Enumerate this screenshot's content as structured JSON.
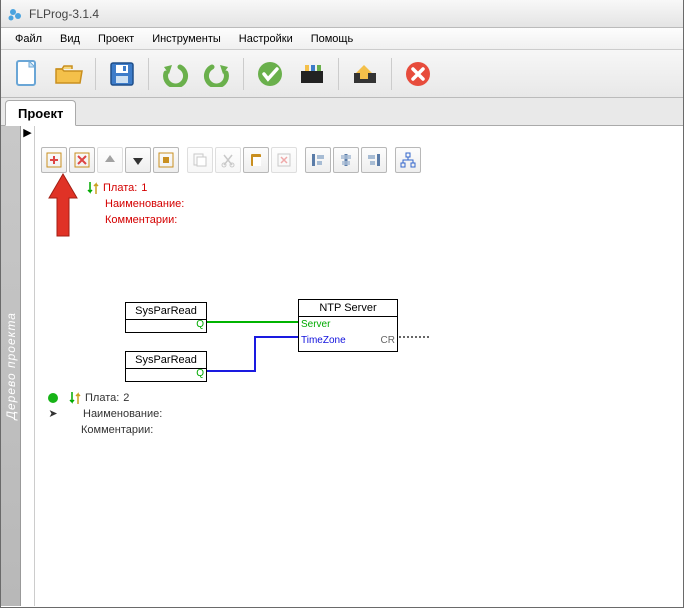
{
  "app": {
    "title": "FLProg-3.1.4"
  },
  "menu": {
    "file": "Файл",
    "view": "Вид",
    "project": "Проект",
    "tools": "Инструменты",
    "settings": "Настройки",
    "help": "Помощь"
  },
  "tab": {
    "project": "Проект"
  },
  "sidebar": {
    "label": "Дерево проекта"
  },
  "board1": {
    "plate_label": "Плата:",
    "plate_num": "1",
    "name_label": "Наименование:",
    "comment_label": "Комментарии:"
  },
  "board2": {
    "plate_label": "Плата:",
    "plate_num": "2",
    "name_label": "Наименование:",
    "comment_label": "Комментарии:"
  },
  "blocks": {
    "spr1": {
      "title": "SysParRead",
      "out": "Q"
    },
    "spr2": {
      "title": "SysParRead",
      "out": "Q"
    },
    "ntp": {
      "title": "NTP Server",
      "in_server": "Server",
      "in_tz": "TimeZone",
      "out_cr": "CR"
    }
  }
}
